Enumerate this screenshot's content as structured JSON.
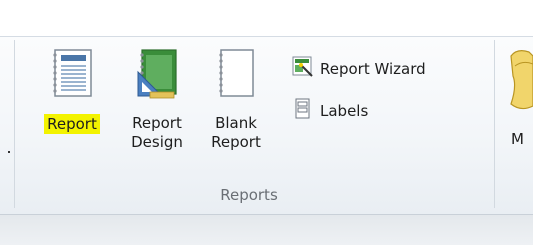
{
  "ribbon": {
    "report_label": "Report",
    "report_design_label": "Report\nDesign",
    "blank_report_label": "Blank\nReport",
    "report_wizard_label": "Report Wizard",
    "labels_label": "Labels",
    "group_label": "Reports",
    "next_button_partial_label": "M"
  },
  "colors": {
    "highlight": "#f3f300",
    "report_icon_blue": "#4a76a8",
    "design_icon_green": "#3a8d3a"
  },
  "icons": {
    "report": "report-icon",
    "report_design": "report-design-icon",
    "blank_report": "blank-report-icon",
    "report_wizard": "report-wizard-icon",
    "labels": "labels-icon",
    "macro": "macro-icon"
  }
}
